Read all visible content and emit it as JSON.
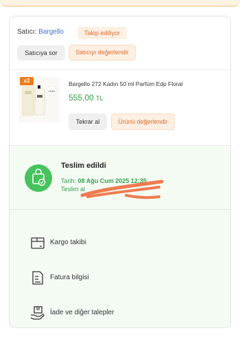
{
  "seller": {
    "label": "Satıcı:",
    "name": "Bargello",
    "follow_status": "Takip ediliyor",
    "ask_button": "Satıcıya sor",
    "rate_button": "Satıcıyı değerlendir"
  },
  "product": {
    "quantity": "x2",
    "name": "Bargello 272 Kadın 50 ml Parfüm Edp Floral",
    "price": "555,00",
    "currency": "TL",
    "buy_again_button": "Tekrar al",
    "rate_button": "Ürünü değerlendir"
  },
  "delivery": {
    "title": "Teslim edildi",
    "date_label": "Tarih:",
    "date_value": "08 Ağu Cum 2025 12:35",
    "received_by": "Teslim al"
  },
  "menu": {
    "items": [
      {
        "label": "Kargo takibi",
        "icon": "package-icon"
      },
      {
        "label": "Fatura bilgisi",
        "icon": "invoice-icon"
      },
      {
        "label": "İade ve diğer talepler",
        "icon": "return-hand-icon"
      }
    ]
  },
  "colors": {
    "accent_orange": "#e46a2c",
    "success_green": "#46c35c",
    "link_blue": "#3b6fd6"
  }
}
